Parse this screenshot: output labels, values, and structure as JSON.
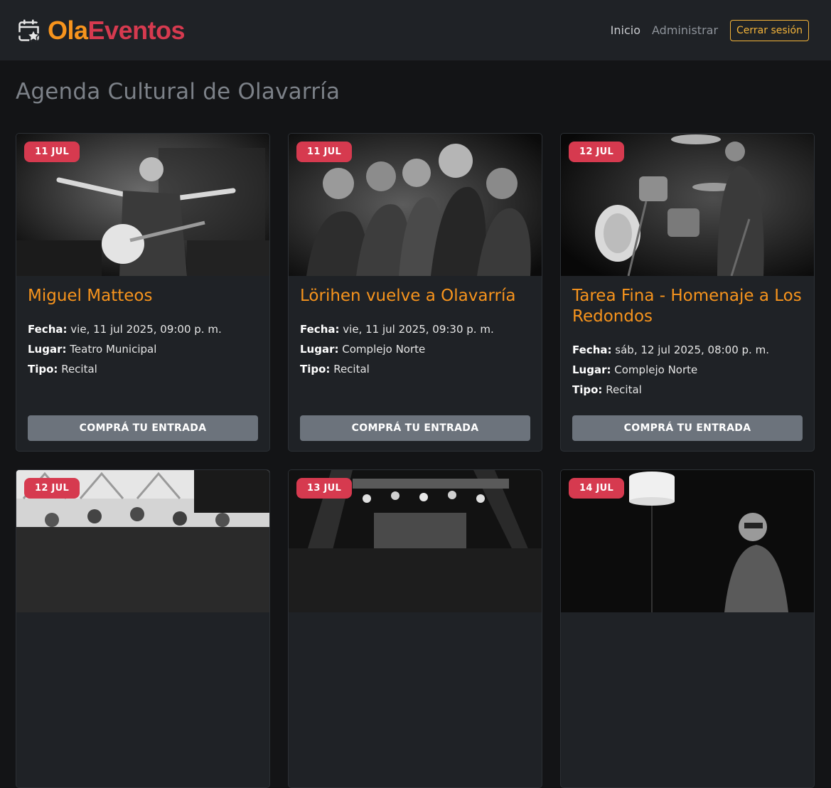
{
  "navbar": {
    "brand_part1": "Ola",
    "brand_part2": "Eventos",
    "brand_icon": "calendar-star-icon",
    "links": [
      "Inicio",
      "Administrar"
    ],
    "logout_label": "Cerrar sesión"
  },
  "page": {
    "title": "Agenda Cultural de Olavarría"
  },
  "labels": {
    "fecha": "Fecha:",
    "lugar": "Lugar:",
    "tipo": "Tipo:",
    "cta": "COMPRÁ TU ENTRADA"
  },
  "events": [
    {
      "badge": "11 JUL",
      "title": "Miguel Matteos",
      "fecha": "vie, 11 jul 2025, 09:00 p. m.",
      "lugar": "Teatro Municipal",
      "tipo": "Recital"
    },
    {
      "badge": "11 JUL",
      "title": "Lörihen vuelve a Olavarría",
      "fecha": "vie, 11 jul 2025, 09:30 p. m.",
      "lugar": "Complejo Norte",
      "tipo": "Recital"
    },
    {
      "badge": "12 JUL",
      "title": "Tarea Fina - Homenaje a Los Redondos",
      "fecha": "sáb, 12 jul 2025, 08:00 p. m.",
      "lugar": "Complejo Norte",
      "tipo": "Recital"
    },
    {
      "badge": "12 JUL"
    },
    {
      "badge": "13 JUL"
    },
    {
      "badge": "14 JUL"
    }
  ],
  "colors": {
    "accent": "#f7941d",
    "brand_red": "#d63a4f",
    "badge": "#d63a4f",
    "button": "#6c737c",
    "card": "#1f2226"
  }
}
